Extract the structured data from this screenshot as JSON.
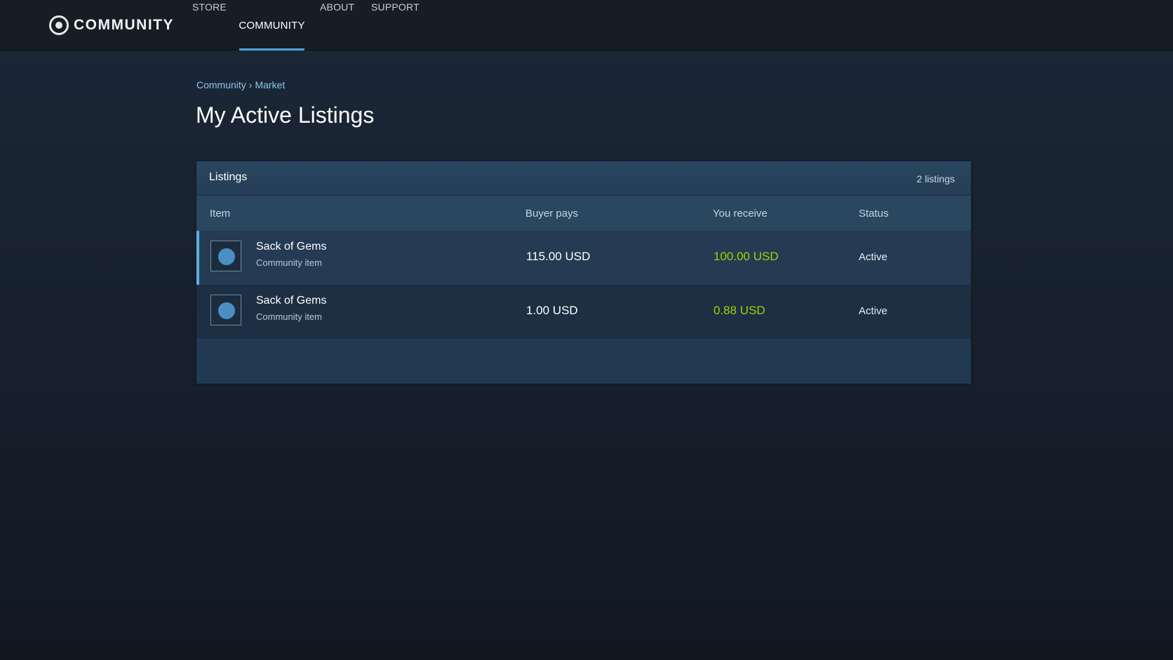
{
  "header": {
    "logo_text": "COMMUNITY",
    "nav": {
      "store": "STORE",
      "community": "COMMUNITY",
      "about": "ABOUT",
      "support": "SUPPORT"
    },
    "active_tab": "COMMUNITY",
    "accent_color": "#4ea4d8"
  },
  "breadcrumb": {
    "items": [
      "Community",
      "Market"
    ],
    "separator": "›"
  },
  "page_title": "My Active Listings",
  "listings_panel": {
    "title": "Listings",
    "count_label": "2 listings",
    "columns": {
      "item": "Item",
      "buyer_pays": "Buyer pays",
      "you_receive": "You receive",
      "status": "Status"
    },
    "rows": [
      {
        "name": "Sack of Gems",
        "type": "Community item",
        "buyer_pays": "115.00 USD",
        "you_receive": "100.00 USD",
        "status": "Active",
        "icon": "gem-icon"
      },
      {
        "name": "Sack of Gems",
        "type": "Community item",
        "buyer_pays": "1.00 USD",
        "you_receive": "0.88 USD",
        "status": "Active",
        "icon": "gem-icon"
      }
    ],
    "receive_color": "#a4d007"
  }
}
